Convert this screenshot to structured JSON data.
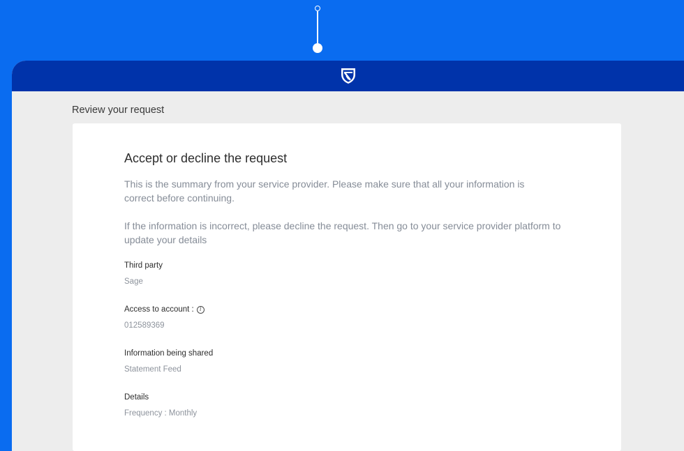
{
  "header": {
    "logo_icon": "bank-shield-logo"
  },
  "page": {
    "title": "Review your request"
  },
  "card": {
    "title": "Accept or decline the request",
    "summary": "This is the summary from your service provider. Please make sure that all your information is correct before continuing.",
    "notice": "If the information is incorrect, please decline the request. Then go to your service provider platform to update your details",
    "fields": [
      {
        "label": "Third party",
        "value": "Sage"
      },
      {
        "label": "Access to account :",
        "value": "012589369"
      },
      {
        "label": "Information being shared",
        "value": "Statement Feed"
      },
      {
        "label": "Details",
        "value": "Frequency : Monthly"
      }
    ],
    "info_icon_glyph": "i"
  },
  "colors": {
    "background": "#0a6cf0",
    "header": "#0033aa",
    "panel": "#ededed"
  }
}
